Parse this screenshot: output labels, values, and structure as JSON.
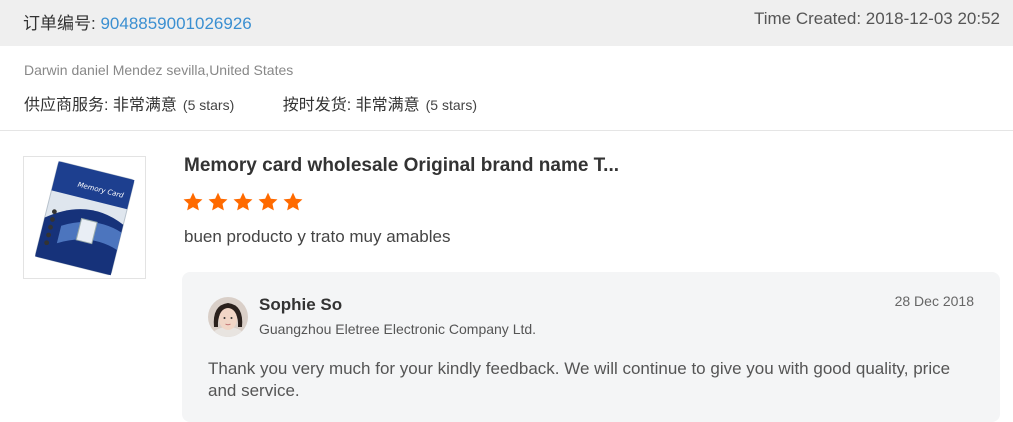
{
  "order": {
    "label": "订单编号: ",
    "number": "9048859001026926",
    "time_created": "Time Created: 2018-12-03 20:52"
  },
  "buyer": "Darwin daniel Mendez sevilla,United States",
  "ratings": [
    {
      "label": "供应商服务: ",
      "value": "非常满意",
      "stars_text": "(5 stars)",
      "stars": 5
    },
    {
      "label": "按时发货: ",
      "value": "非常满意",
      "stars_text": "(5 stars)",
      "stars": 5
    }
  ],
  "review": {
    "product_title": "Memory card wholesale Original brand name T...",
    "rating": 5,
    "text": "buen producto y trato muy amables",
    "thumbnail_text": "Memory Card"
  },
  "reply": {
    "seller_name": "Sophie So",
    "company": "Guangzhou Eletree Electronic Company Ltd.",
    "date": "28 Dec 2018",
    "text": "Thank you very much for your kindly feedback. We will continue to give you with good quality, price and service."
  },
  "colors": {
    "link": "#3a8fd1",
    "star": "#ff6a00",
    "topbar": "#efefef",
    "reply_bg": "#f4f5f6"
  },
  "icons": [
    "star-icon",
    "avatar"
  ]
}
